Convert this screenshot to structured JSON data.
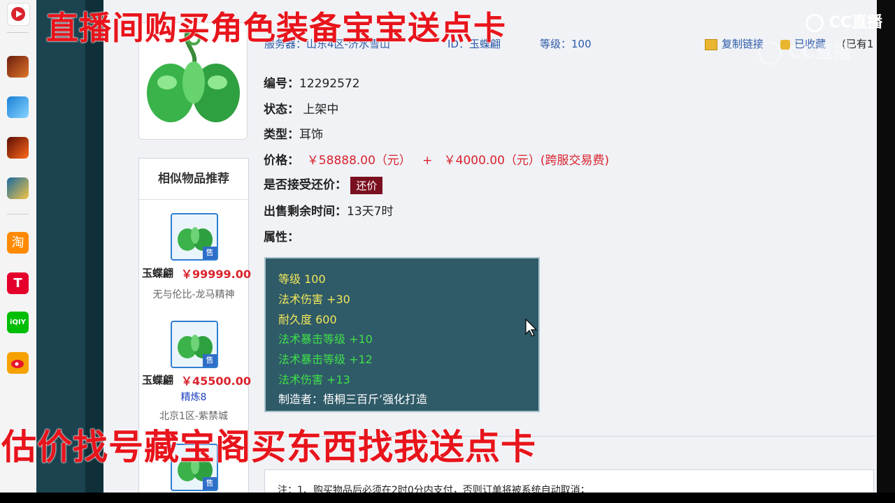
{
  "overlay": {
    "top_caption": "直播间购买角色装备宝宝送点卡",
    "bottom_caption": "估价找号藏宝阁买东西找我送点卡"
  },
  "watermark": {
    "main": "CC直播",
    "secondary": "CC直播"
  },
  "dock": {
    "icons": [
      "cc-live-icon",
      "game-icon",
      "game-icon",
      "game-icon",
      "game-icon",
      "taobao-icon",
      "tmall-icon",
      "iqiyi-icon",
      "weibo-icon"
    ],
    "colors": [
      "#d33",
      "#7a2",
      "#1a7fd6",
      "#c33",
      "#2a8fd0",
      "#ff8a00",
      "#e4002b",
      "#00be06",
      "#f5a100"
    ]
  },
  "header": {
    "server_line": "服务器：山东4区-济水雪山",
    "id_line": "ID：玉蝶翩",
    "level_line": "等级：100",
    "copy_link": "复制链接",
    "favorited": "已收藏",
    "count": "(已有1"
  },
  "item": {
    "id_label": "编号：",
    "id_value": "12292572",
    "status_label": "状态：",
    "status_value": "上架中",
    "type_label": "类型：",
    "type_value": "耳饰",
    "price_label": "价格：",
    "price_value": "￥58888.00（元）",
    "price_plus": "+",
    "fee_value": "￥4000.00（元）(跨服交易费)",
    "counter_label": "是否接受还价：",
    "counter_button": "还价",
    "time_label": "出售剩余时间：",
    "time_value": "13天7时",
    "attr_label": "属性："
  },
  "attributes": [
    {
      "text": "等级  100",
      "color": "#f2e85a"
    },
    {
      "text": "法术伤害  +30",
      "color": "#f2e85a"
    },
    {
      "text": "耐久度  600",
      "color": "#f2e85a"
    },
    {
      "text": "法术暴击等级  +10",
      "color": "#3fe04a"
    },
    {
      "text": "法术暴击等级  +12",
      "color": "#3fe04a"
    },
    {
      "text": "法术伤害  +13",
      "color": "#3fe04a"
    },
    {
      "text": "制造者：梧桐三百斤’强化打造",
      "color": "#ffffff"
    }
  ],
  "sidebar": {
    "title": "相似物品推荐",
    "sale_badge": "售",
    "items": [
      {
        "name": "玉蝶翩",
        "price": "￥99999.00",
        "extra": "",
        "server": "无与伦比-龙马精神"
      },
      {
        "name": "玉蝶翩",
        "price": "￥45500.00",
        "extra": "精炼8",
        "server": "北京1区-紫禁城"
      }
    ]
  },
  "notice": {
    "text": "注：1、购买物品后必须在2时0分内支付，否则订单将被系统自动取消；"
  }
}
